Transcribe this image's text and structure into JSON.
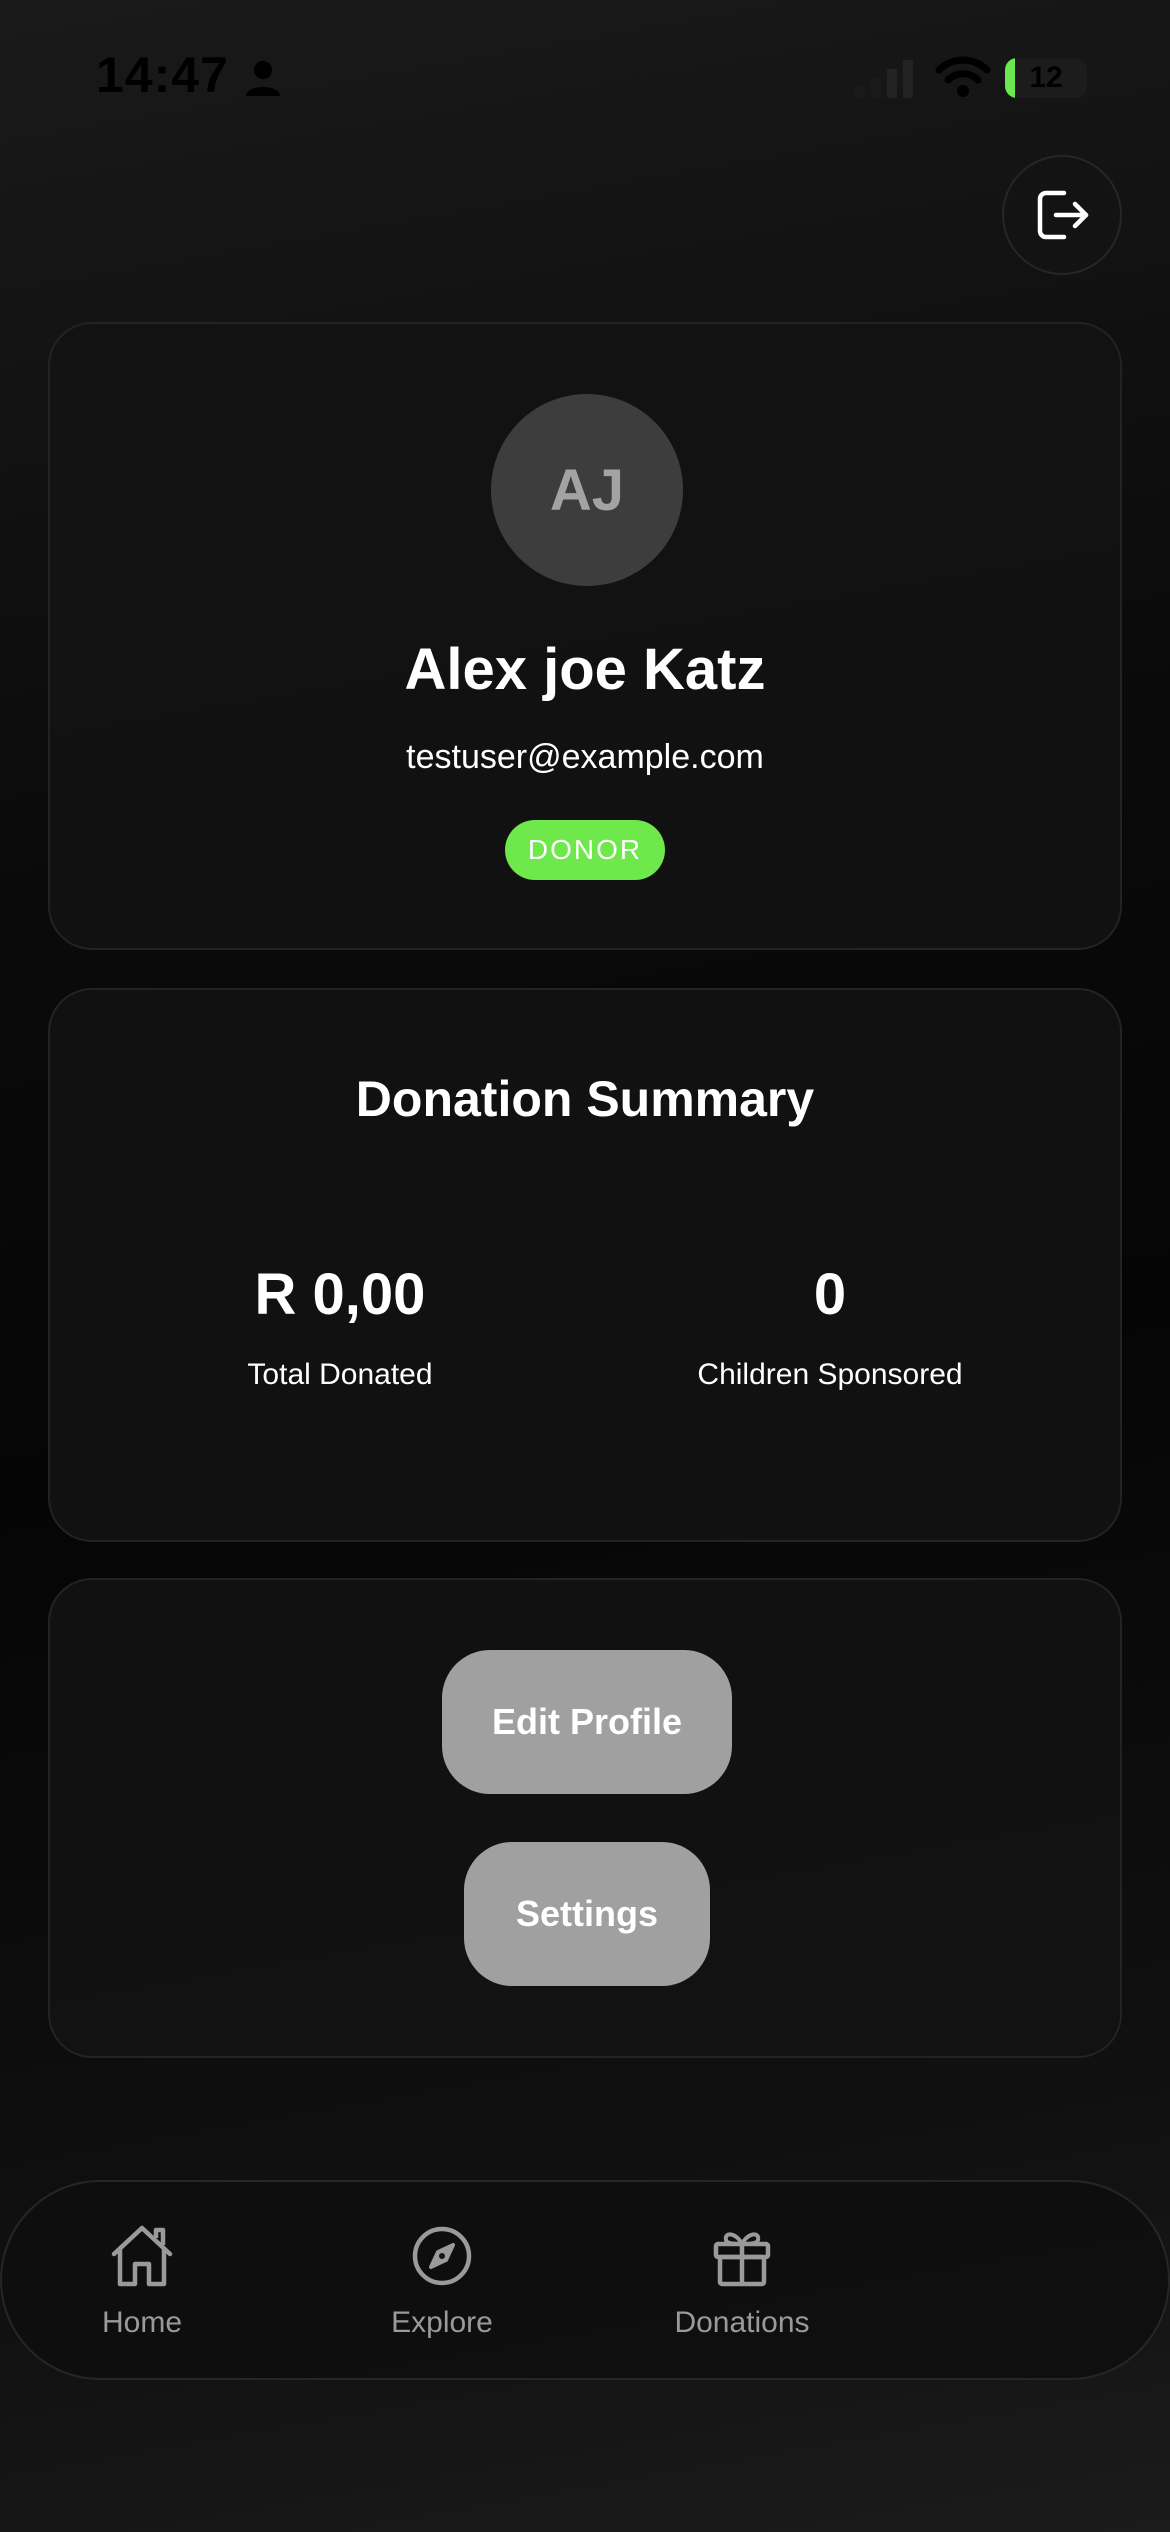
{
  "status_bar": {
    "time": "14:47",
    "battery": "12",
    "battery_fraction": 0.12,
    "icons": [
      "person-icon",
      "signal-icon",
      "wifi-icon",
      "battery-icon"
    ]
  },
  "header": {
    "logout_icon": "logout-icon"
  },
  "profile": {
    "initials": "AJ",
    "name": "Alex joe Katz",
    "email": "testuser@example.com",
    "role": "DONOR"
  },
  "summary": {
    "title": "Donation Summary",
    "total_donated_value": "R 0,00",
    "total_donated_label": "Total Donated",
    "children_sponsored_value": "0",
    "children_sponsored_label": "Children Sponsored"
  },
  "actions": {
    "edit_profile": "Edit Profile",
    "settings": "Settings"
  },
  "nav": {
    "items": [
      {
        "label": "Home",
        "icon": "home-icon"
      },
      {
        "label": "Explore",
        "icon": "compass-icon"
      },
      {
        "label": "Donations",
        "icon": "gift-icon"
      }
    ]
  },
  "colors": {
    "badge": "#6ee84a",
    "button": "#a0a0a0",
    "avatar": "#3d3d3d",
    "nav_inactive": "#9a9a9a"
  }
}
